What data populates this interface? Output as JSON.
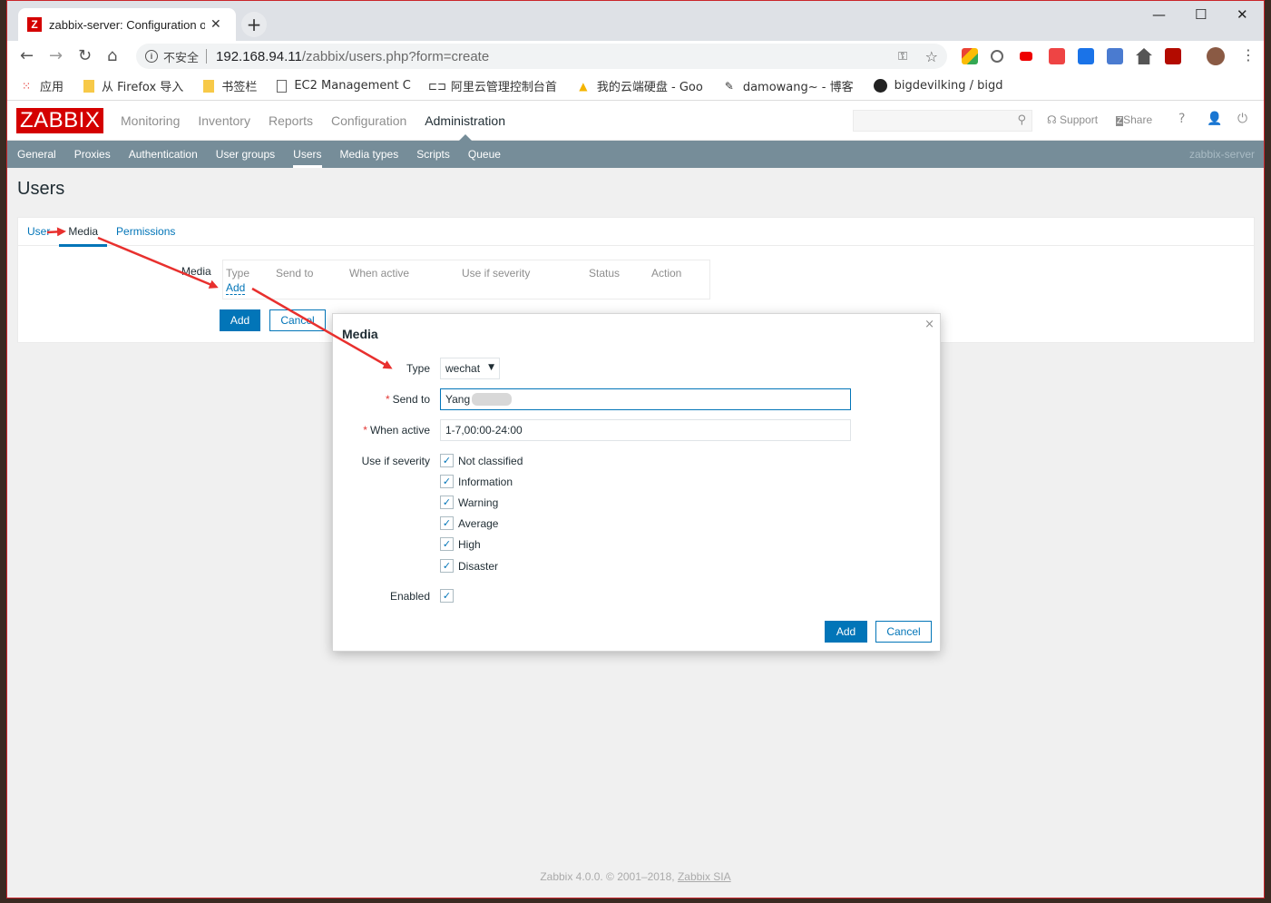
{
  "browser": {
    "tab_title": "zabbix-server: Configuration o",
    "tab_favicon": "Z",
    "address": {
      "insecure_label": "不安全",
      "host": "192.168.94.11",
      "path": "/zabbix/users.php?form=create"
    },
    "bookmarks": [
      {
        "icon": "apps-icon",
        "label": "应用"
      },
      {
        "icon": "folder-icon",
        "label": "从 Firefox 导入"
      },
      {
        "icon": "folder-icon",
        "label": "书签栏"
      },
      {
        "icon": "page-icon",
        "label": "EC2 Management C"
      },
      {
        "icon": "aliyun-icon",
        "label": "阿里云管理控制台首"
      },
      {
        "icon": "drive-icon",
        "label": "我的云端硬盘 - Goo"
      },
      {
        "icon": "blog-icon",
        "label": "damowang~ - 博客"
      },
      {
        "icon": "github-icon",
        "label": "bigdevilking / bigd"
      }
    ]
  },
  "zabbix": {
    "logo": "ZABBIX",
    "menu": [
      "Monitoring",
      "Inventory",
      "Reports",
      "Configuration",
      "Administration"
    ],
    "header_links": {
      "support": "Support",
      "share": "Share",
      "help": "?"
    },
    "submenu": [
      "General",
      "Proxies",
      "Authentication",
      "User groups",
      "Users",
      "Media types",
      "Scripts",
      "Queue"
    ],
    "server_name": "zabbix-server",
    "page_title": "Users",
    "tabs": [
      "User",
      "Media",
      "Permissions"
    ],
    "media_label": "Media",
    "media_columns": [
      "Type",
      "Send to",
      "When active",
      "Use if severity",
      "Status",
      "Action"
    ],
    "media_add_link": "Add",
    "add_button": "Add",
    "cancel_button": "Cancel",
    "footer_prefix": "Zabbix 4.0.0. © 2001–2018, ",
    "footer_link": "Zabbix SIA"
  },
  "modal": {
    "title": "Media",
    "close": "×",
    "type_label": "Type",
    "type_value": "wechat",
    "send_to_label": "Send to",
    "send_to_value": "Yang",
    "when_active_label": "When active",
    "when_active_value": "1-7,00:00-24:00",
    "severity_label": "Use if severity",
    "severities": [
      "Not classified",
      "Information",
      "Warning",
      "Average",
      "High",
      "Disaster"
    ],
    "enabled_label": "Enabled",
    "add_button": "Add",
    "cancel_button": "Cancel"
  },
  "colors": {
    "zabbix_red": "#d40000",
    "submenu_bg": "#768d99",
    "link_blue": "#0275b8",
    "annotation_red": "#e8302e"
  }
}
